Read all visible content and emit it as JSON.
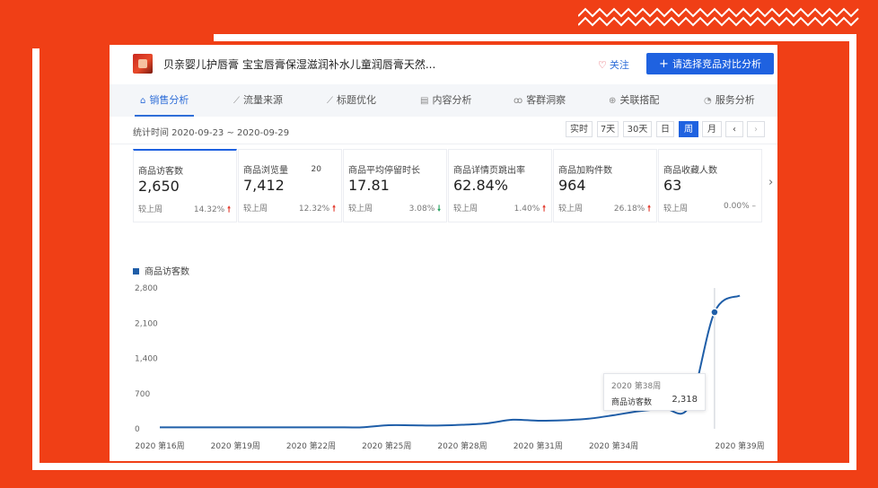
{
  "product": {
    "title": "贝亲婴儿护唇膏 宝宝唇膏保湿滋润补水儿童润唇膏天然...",
    "follow_label": "关注",
    "compare_label": "请选择竞品对比分析"
  },
  "tabs": [
    {
      "label": "销售分析",
      "icon": "home-icon"
    },
    {
      "label": "流量来源",
      "icon": "trend-icon"
    },
    {
      "label": "标题优化",
      "icon": "trend-icon"
    },
    {
      "label": "内容分析",
      "icon": "document-icon"
    },
    {
      "label": "客群洞察",
      "icon": "users-icon"
    },
    {
      "label": "关联搭配",
      "icon": "link-icon"
    },
    {
      "label": "服务分析",
      "icon": "service-icon"
    }
  ],
  "date_range": {
    "label": "统计时间 2020-09-23 ~ 2020-09-29",
    "periods": [
      "实时",
      "7天",
      "30天",
      "日",
      "周",
      "月"
    ],
    "selected": "周"
  },
  "metrics": [
    {
      "name": "商品访客数",
      "value": "2,650",
      "compare_label": "较上周",
      "change": "14.32%",
      "direction": "up"
    },
    {
      "name": "商品浏览量",
      "badge": "20",
      "value": "7,412",
      "compare_label": "较上周",
      "change": "12.32%",
      "direction": "up"
    },
    {
      "name": "商品平均停留时长",
      "value": "17.81",
      "compare_label": "较上周",
      "change": "3.08%",
      "direction": "down"
    },
    {
      "name": "商品详情页跳出率",
      "value": "62.84%",
      "compare_label": "较上周",
      "change": "1.40%",
      "direction": "up"
    },
    {
      "name": "商品加购件数",
      "value": "964",
      "compare_label": "较上周",
      "change": "26.18%",
      "direction": "up"
    },
    {
      "name": "商品收藏人数",
      "value": "63",
      "compare_label": "较上周",
      "change": "0.00%",
      "direction": "flat"
    }
  ],
  "colors": {
    "accent": "#1f62e0",
    "line": "#1f5ea8",
    "up": "#e23b2e",
    "down": "#23a15d",
    "background": "#f03f16"
  },
  "chart_data": {
    "type": "line",
    "series": [
      {
        "name": "商品访客数",
        "x": [
          16,
          17,
          18,
          19,
          20,
          21,
          22,
          23,
          24,
          25,
          26,
          27,
          28,
          29,
          30,
          31,
          32,
          33,
          34,
          35,
          36,
          37,
          38,
          39
        ],
        "values": [
          30,
          30,
          30,
          30,
          30,
          30,
          30,
          30,
          30,
          70,
          70,
          65,
          80,
          110,
          180,
          160,
          170,
          200,
          270,
          350,
          400,
          450,
          2318,
          2650
        ]
      }
    ],
    "x_tick_labels": [
      "2020 第16周",
      "2020 第19周",
      "2020 第22周",
      "2020 第25周",
      "2020 第28周",
      "2020 第31周",
      "2020 第34周",
      "2020 第39周"
    ],
    "x_ticks": [
      16,
      19,
      22,
      25,
      28,
      31,
      34,
      39
    ],
    "y_tick_labels": [
      "0",
      "700",
      "1,400",
      "2,100",
      "2,800"
    ],
    "y_ticks": [
      0,
      700,
      1400,
      2100,
      2800
    ],
    "ylim": [
      0,
      2800
    ],
    "xlim": [
      16,
      39
    ],
    "grid": false,
    "highlight": {
      "x": 38,
      "y": 2318
    },
    "tooltip": {
      "title": "2020 第38周",
      "name": "商品访客数",
      "value": "2,318"
    }
  }
}
